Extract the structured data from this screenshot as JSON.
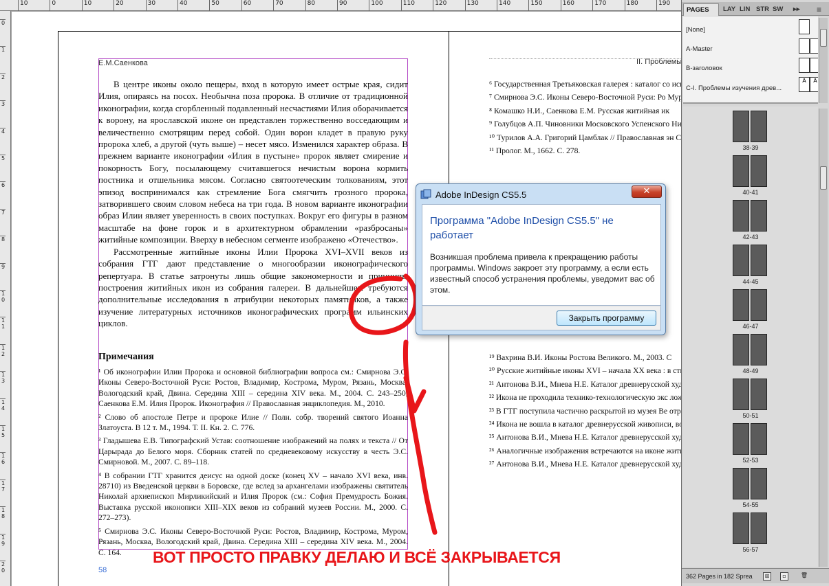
{
  "ruler": {
    "h_ticks": [
      "10",
      "0",
      "10",
      "20",
      "30",
      "40",
      "50",
      "60",
      "70",
      "80",
      "90",
      "100",
      "110",
      "120",
      "130",
      "140",
      "150",
      "160",
      "170",
      "180",
      "190",
      "200"
    ],
    "v_ticks": [
      "0",
      "1",
      "2",
      "3",
      "4",
      "5",
      "6",
      "7",
      "8",
      "9",
      "10",
      "11",
      "12",
      "13",
      "14",
      "15",
      "16",
      "17",
      "18",
      "19",
      "20"
    ]
  },
  "left_page": {
    "running_head": "Е.М.Саенкова",
    "page_number": "58",
    "body": [
      "В центре иконы около пещеры, вход в которую имеет острые края, сидит Илия, опираясь на посох. Необычна поза пророка. В отличие от традиционной иконографии, когда сгорбленный подавленный несчастиями Илия оборачивается к ворону, на ярославской иконе он представлен торжественно восседающим и величественно смотрящим перед собой. Один ворон кладет в правую руку пророка хлеб, а другой (чуть выше) – несет мясо. Изменился характер образа. В прежнем варианте иконографии «Илия в пустыне» пророк являет смирение и покорность Богу, посылающему считавшегося нечистым ворона кормить постника и отшельника мясом. Согласно святоотеческим толкованиям, этот эпизод воспринимался как стремление Бога смягчить грозного пророка, затворившего своим словом небеса на три года. В новом варианте иконографии образ Илии являет уверенность в своих поступках. Вокруг его фигуры в разном масштабе на фоне горок и в архитектурном обрамлении «разбросаны» житийные композиции. Вверху в небесном сегменте изображено «Отечество».",
      "Рассмотренные житийные иконы Илии Пророка XVI–XVII веков из собрания ГТГ дают представление о многообразии иконографического репертуара. В статье затронуты лишь общие закономерности и принципы построения житийных икон из собрания галереи. В дальнейшем требуются дополнительные исследования в атрибуции некоторых памятников, а также изучение литературных источников иконографических программ ильинских циклов."
    ],
    "notes_heading": "Примечания",
    "notes": [
      "¹ Об иконографии Илии Пророка и основной библиографии вопроса см.: Смирнова Э.С. Иконы Северо-Восточной Руси: Ростов, Владимир, Кострома, Муром, Рязань, Москва, Вологодский край, Двина. Середина XIII – середина XIV века. М., 2004. С. 243–250; Саенкова Е.М. Илия Пророк. Иконография // Православная энциклопедия. М., 2010.",
      "² Слово об апостоле Петре и пророке Илие // Полн. собр. творений святого Иоанна Златоуста. В 12 т. М., 1994. Т. II. Кн. 2. С. 776.",
      "³ Гладышева Е.В. Типографский Устав: соотношение изображений на полях и текста // От Царырада до Белого моря. Сборник статей по средневековому искусству в честь Э.С. Смирновой. М., 2007. С. 89–118.",
      "⁴ В собрании ГТГ хранится деисус на одной доске (конец XV – начало XVI века, инв. 28710) из Введенской церкви в Боровске, где вслед за архангелами изображены святитель Николай архиепископ Мирликийский и Илия Пророк (см.: София Премудрость Божия. Выставка русской иконописи XIII–XIX веков из собраний музеев России. М., 2000. С. 272–273).",
      "⁵ Смирнова Э.С. Иконы Северо-Восточной Руси: Ростов, Владимир, Кострома, Муром, Рязань, Москва, Вологодский край, Двина. Середина XIII – середина XIV века. М., 2004. С. 164."
    ]
  },
  "right_page": {
    "running_head": "II. Проблемы изуч",
    "notes_top": [
      "⁶ Государственная Третьяковская галерея : каталог со искусству X – начала XV века. М., 1995. С. 87–89.",
      "⁷ Смирнова Э.С. Иконы Северо-Восточной Руси: Ро Муром, Рязань, Москва, Вологодский край, Двина. Се века. М., 2004. С. 245.",
      "⁸ Комашко Н.И., Саенкова Е.М. Русская житийная ик",
      "⁹ Голубцов А.П. Чиновники Московского Успенского Никона. М., 1908. С. 65.",
      "¹⁰ Турилов А.А. Григорий Цамблак // Православная эн С. 583–592.",
      "¹¹ Пролог. М., 1662. С. 278."
    ],
    "notes_bottom": [
      "¹⁹ Вахрина В.И. Иконы Ростова Великого. М., 2003. С",
      "²⁰ Русские житийные иконы XVI – начала XX века : в ственный Эрмитаж. СПб., 1999. С. 16–17.",
      "²¹ Антонова В.И., Мнева Н.Е. Каталог древнерусской художественной классификации. В 2 т. М., 1963. Т. II. С",
      "²² Икона не проходила технико-технологическую экс ложение о том, что икона могла быть написана в XIX имитирует древний образец.",
      "²³ В ГТГ поступила частично раскрытой из музея Ве отреставрирована в 2004 году А.С. Валюшком.",
      "²⁴ Икона не вошла в каталог древнерусской живописи, вой и Н.Е. Мневой.",
      "²⁵ Антонова В.И., Мнева Н.Е. Каталог древнерусской художественной классификации. В 2 т. М., 1963. Т. II. С",
      "²⁶ Аналогичные изображения встречаются на иконе житием» (вторая половина XVII века, собрание А.В. А",
      "²⁷ Антонова В.И., Мнева Н.Е. Каталог древнерусской художественной классификации. В 2 т. М., 1963. Т. II. С"
    ]
  },
  "dialog": {
    "title": "Adobe InDesign CS5.5",
    "close_glyph": "✕",
    "heading": "Программа \"Adobe InDesign CS5.5\" не работает",
    "message": "Возникшая проблема привела к прекращению работы программы. Windows закроет эту программу, а если есть известный способ устранения проблемы, уведомит вас об этом.",
    "button": "Закрыть программу"
  },
  "annotation": {
    "caption": "ВОТ ПРОСТО ПРАВКУ ДЕЛАЮ И ВСЁ ЗАКРЫВАЕТСЯ",
    "color": "#e8161a"
  },
  "panel": {
    "tabs": [
      "PAGES",
      "LAY",
      "LIN",
      "STR",
      "SW"
    ],
    "tab_arrows": "▸▸",
    "menu_glyph": "≡",
    "masters": [
      {
        "label": "[None]",
        "left": "",
        "right": ""
      },
      {
        "label": "A-Master",
        "left": "",
        "right": ""
      },
      {
        "label": "B-заголовок",
        "left": "",
        "right": ""
      },
      {
        "label": "C-I. Проблемы изучения древ...",
        "left": "A",
        "right": "A"
      }
    ],
    "spreads": [
      "38-39",
      "40-41",
      "42-43",
      "44-45",
      "46-47",
      "48-49",
      "50-51",
      "52-53",
      "54-55",
      "56-57"
    ],
    "status": "362 Pages in 182 Sprea",
    "status_icons": [
      "⊞",
      "▫",
      "🗑"
    ]
  }
}
